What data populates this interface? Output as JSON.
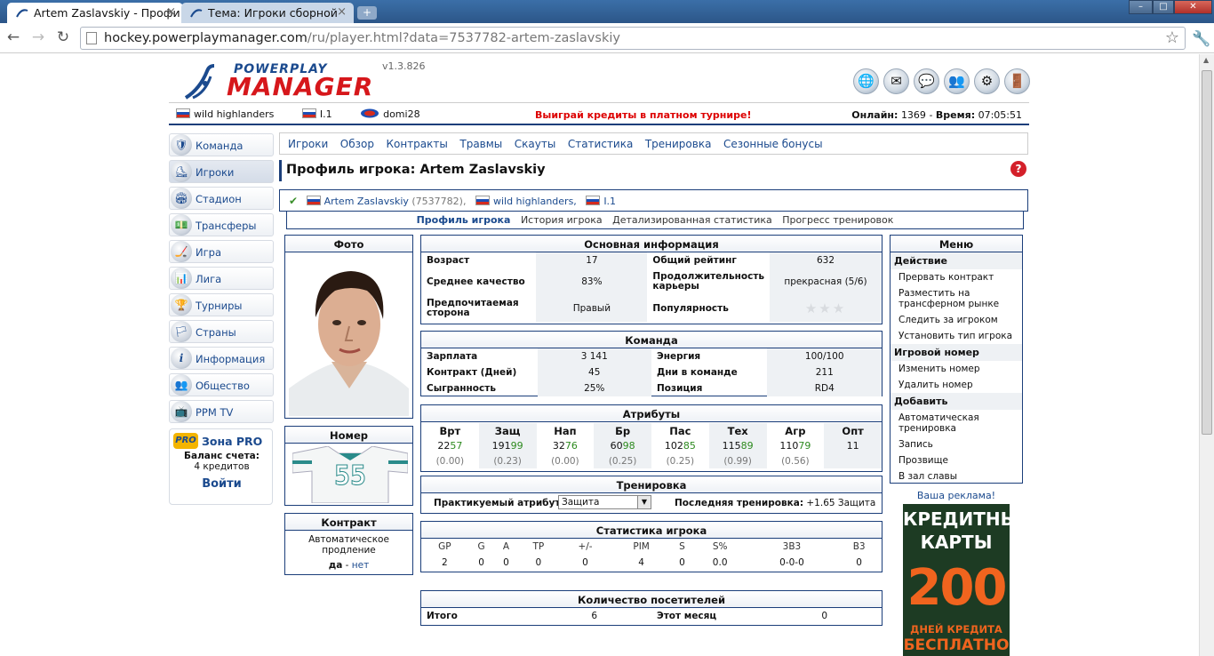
{
  "browser": {
    "tabs": [
      {
        "title": "Artem Zaslavskiy - Профи"
      },
      {
        "title": "Тема: Игроки сборной"
      }
    ],
    "url_host": "hockey.powerplaymanager.com",
    "url_path": "/ru/player.html?data=7537782-artem-zaslavskiy"
  },
  "header": {
    "logo_top": "POWERPLAY",
    "logo_main": "MANAGER",
    "version": "v1.3.826"
  },
  "infobar": {
    "team": "wild highlanders",
    "league": "I.1",
    "user": "domi28",
    "promo": "Выиграй кредиты в платном турнире!",
    "online_label": "Онлайн:",
    "online_value": "1369",
    "time_sep": "-",
    "time_label": "Время:",
    "time_value": "07:05:51"
  },
  "sidebar": {
    "items": [
      {
        "label": "Команда",
        "icon": "🛡"
      },
      {
        "label": "Игроки",
        "icon": "⛸"
      },
      {
        "label": "Стадион",
        "icon": "🏟"
      },
      {
        "label": "Трансферы",
        "icon": "💵"
      },
      {
        "label": "Игра",
        "icon": "🏒"
      },
      {
        "label": "Лига",
        "icon": "📊"
      },
      {
        "label": "Турниры",
        "icon": "🏆"
      },
      {
        "label": "Страны",
        "icon": "🏳"
      },
      {
        "label": "Информация",
        "icon": "i"
      },
      {
        "label": "Общество",
        "icon": "👥"
      },
      {
        "label": "PPM TV",
        "icon": "📺"
      }
    ],
    "pro": {
      "icon": "PRO",
      "title": "Зона PRO",
      "balance_label": "Баланс счета:",
      "credits": "4 кредитов",
      "login": "Войти"
    }
  },
  "subnav": [
    "Игроки",
    "Обзор",
    "Контракты",
    "Травмы",
    "Скауты",
    "Статистика",
    "Тренировка",
    "Сезонные бонусы"
  ],
  "title": "Профиль игрока: Artem Zaslavskiy",
  "breadcrumb": {
    "player": "Artem Zaslavskiy",
    "player_id": "(7537782),",
    "team": "wild highlanders,",
    "league": "I.1"
  },
  "profile_tabs": [
    "Профиль игрока",
    "История игрока",
    "Детализированная статистика",
    "Прогресс тренировок"
  ],
  "photo": {
    "title": "Фото"
  },
  "number": {
    "title": "Номер",
    "value": "55"
  },
  "contract": {
    "title": "Контракт",
    "text": "Автоматическое продление",
    "yes": "да",
    "sep": "-",
    "no": "нет"
  },
  "basic": {
    "title": "Основная информация",
    "rows": [
      {
        "l1": "Возраст",
        "v1": "17",
        "l2": "Общий рейтинг",
        "v2": "632"
      },
      {
        "l1": "Среднее качество",
        "v1": "83%",
        "l2": "Продолжительность карьеры",
        "v2": "прекрасная (5/6)"
      },
      {
        "l1": "Предпочитаемая сторона",
        "v1": "Правый",
        "l2": "Популярность",
        "v2": "★★★"
      }
    ]
  },
  "team": {
    "title": "Команда",
    "rows": [
      {
        "l1": "Зарплата",
        "v1": "3 141",
        "l2": "Энергия",
        "v2": "100/100"
      },
      {
        "l1": "Контракт (Дней)",
        "v1": "45",
        "l2": "Дни в команде",
        "v2": "211"
      },
      {
        "l1": "Сыгранность",
        "v1": "25%",
        "l2": "Позиция",
        "v2": "RD4"
      }
    ]
  },
  "attributes": {
    "title": "Атрибуты",
    "cols": [
      {
        "name": "Врт",
        "base": "22",
        "inc": "57",
        "delta": "(0.00)"
      },
      {
        "name": "Защ",
        "base": "191",
        "inc": "99",
        "delta": "(0.23)"
      },
      {
        "name": "Нап",
        "base": "32",
        "inc": "76",
        "delta": "(0.00)"
      },
      {
        "name": "Бр",
        "base": "60",
        "inc": "98",
        "delta": "(0.25)"
      },
      {
        "name": "Пас",
        "base": "102",
        "inc": "85",
        "delta": "(0.25)"
      },
      {
        "name": "Тех",
        "base": "115",
        "inc": "89",
        "delta": "(0.99)"
      },
      {
        "name": "Агр",
        "base": "110",
        "inc": "79",
        "delta": "(0.56)"
      },
      {
        "name": "Опт",
        "base": "11",
        "inc": "",
        "delta": ""
      }
    ]
  },
  "training": {
    "title": "Тренировка",
    "attr_label": "Практикуемый атрибут:",
    "attr_value": "Защита",
    "last_label": "Последняя тренировка:",
    "last_value": "+1.65 Защита"
  },
  "stats": {
    "title": "Статистика игрока",
    "headers": [
      "GP",
      "G",
      "A",
      "TP",
      "+/-",
      "PIM",
      "S",
      "S%",
      "3B3",
      "B3"
    ],
    "values": [
      "2",
      "0",
      "0",
      "0",
      "0",
      "4",
      "0",
      "0.0",
      "0-0-0",
      "0"
    ]
  },
  "visitors": {
    "title": "Количество посетителей",
    "l1": "Итого",
    "v1": "6",
    "l2": "Этот месяц",
    "v2": "0"
  },
  "menu": {
    "title": "Меню",
    "sections": [
      {
        "header": "Действие",
        "items": [
          "Прервать контракт",
          "Разместить на трансферном рынке",
          "Следить за игроком",
          "Установить тип игрока"
        ]
      },
      {
        "header": "Игровой номер",
        "items": [
          "Изменить номер",
          "Удалить номер"
        ]
      },
      {
        "header": "Добавить",
        "items": [
          "Автоматическая тренировка",
          "Запись",
          "Прозвище",
          "В зал славы"
        ]
      }
    ]
  },
  "ad": {
    "label": "Ваша реклама!",
    "line1": "КРЕДИТНЫЕ",
    "line2": "КАРТЫ",
    "number": "200",
    "line3": "ДНЕЙ КРЕДИТА",
    "line4": "БЕСПЛАТНО"
  },
  "colors": {
    "brand_blue": "#1b4a8e",
    "brand_red": "#d6171b",
    "attr_increase": "#2d8a1f"
  }
}
